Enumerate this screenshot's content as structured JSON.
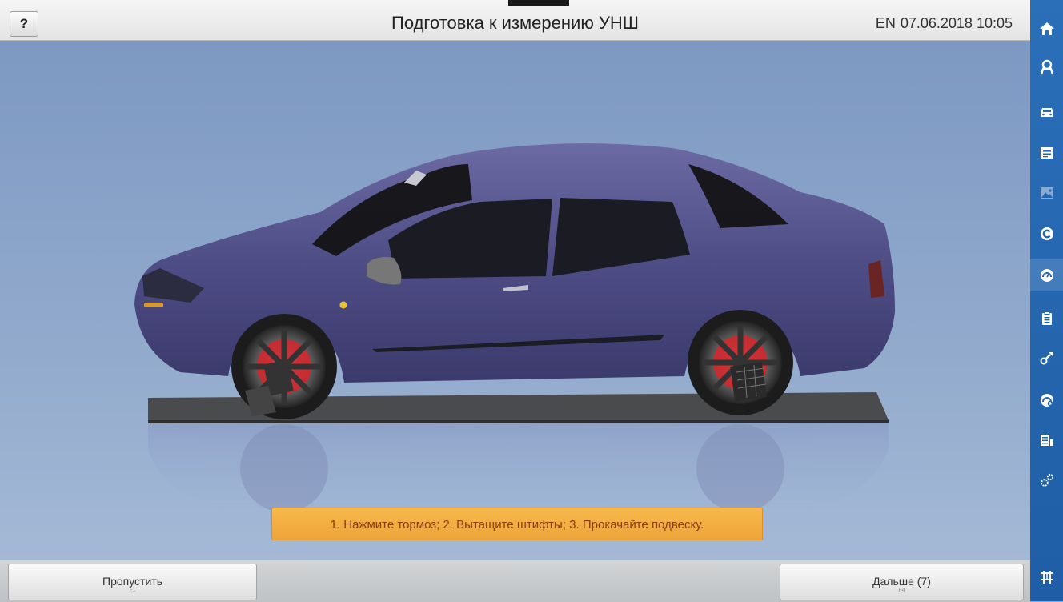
{
  "titlebar": {
    "help_label": "?",
    "title": "Подготовка к измерению УНШ",
    "lang": "EN",
    "datetime": "07.06.2018 10:05"
  },
  "sidebar": {
    "items": [
      {
        "icon": "home-icon",
        "active": false,
        "dim": false
      },
      {
        "icon": "customer-icon",
        "active": false,
        "dim": false
      },
      {
        "icon": "car-icon",
        "active": false,
        "dim": false
      },
      {
        "icon": "list-icon",
        "active": false,
        "dim": false
      },
      {
        "icon": "image-icon",
        "active": false,
        "dim": true
      },
      {
        "icon": "c-circle-icon",
        "active": false,
        "dim": false
      },
      {
        "icon": "gauge-icon",
        "active": true,
        "dim": false
      },
      {
        "icon": "clipboard-icon",
        "active": false,
        "dim": false
      },
      {
        "icon": "wrench-icon",
        "active": false,
        "dim": false
      },
      {
        "icon": "gauge-plus-icon",
        "active": false,
        "dim": false
      },
      {
        "icon": "report-icon",
        "active": false,
        "dim": false
      },
      {
        "icon": "settings-gears-icon",
        "active": false,
        "dim": false
      },
      {
        "icon": "lift-icon",
        "active": false,
        "dim": false
      }
    ],
    "accent": "#2466b0"
  },
  "instruction": "1. Нажмите тормоз;  2. Вытащите штифты;  3. Прокачайте подвеску.",
  "buttons": {
    "skip_label": "Пропустить",
    "skip_key": "F1",
    "next_label": "Дальше (7)",
    "next_key": "F4"
  }
}
